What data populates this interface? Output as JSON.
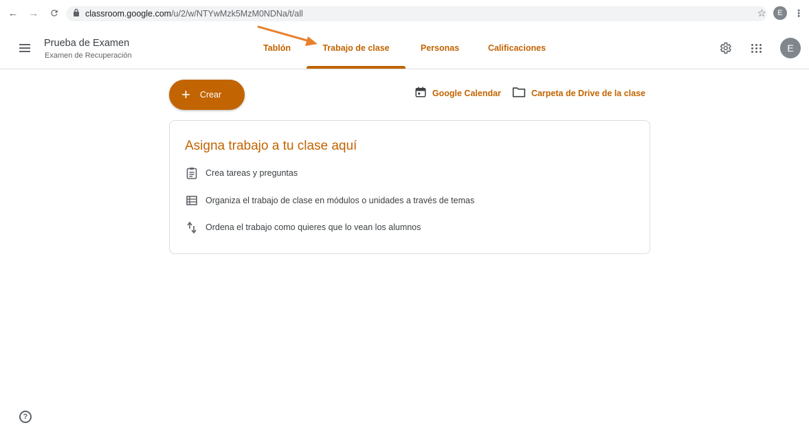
{
  "browser": {
    "url_host": "classroom.google.com",
    "url_path": "/u/2/w/NTYwMzk5MzM0NDNa/t/all",
    "profile_initial": "E",
    "icons": [
      "back-arrow-icon",
      "forward-arrow-icon",
      "reload-icon",
      "lock-icon",
      "star-icon",
      "kebab-menu-icon"
    ]
  },
  "header": {
    "class_title": "Prueba de Examen",
    "class_subtitle": "Examen de Recuperación",
    "tabs": [
      {
        "label": "Tablón",
        "active": false
      },
      {
        "label": "Trabajo de clase",
        "active": true
      },
      {
        "label": "Personas",
        "active": false
      },
      {
        "label": "Calificaciones",
        "active": false
      }
    ],
    "user_initial": "E",
    "icons": [
      "hamburger-menu-icon",
      "gear-icon",
      "apps-grid-icon"
    ]
  },
  "toolbar": {
    "create_label": "Crear",
    "calendar_label": "Google Calendar",
    "drive_label": "Carpeta de Drive de la clase"
  },
  "card": {
    "title": "Asigna trabajo a tu clase aquí",
    "items": [
      {
        "icon": "assignment-icon",
        "text": "Crea tareas y preguntas"
      },
      {
        "icon": "topic-list-icon",
        "text": "Organiza el trabajo de clase en módulos o unidades a través de temas"
      },
      {
        "icon": "reorder-arrows-icon",
        "text": "Ordena el trabajo como quieres que lo vean los alumnos"
      }
    ]
  },
  "colors": {
    "accent": "#c26401",
    "annotation_arrow": "#e8812e",
    "avatar": "#80868b"
  }
}
